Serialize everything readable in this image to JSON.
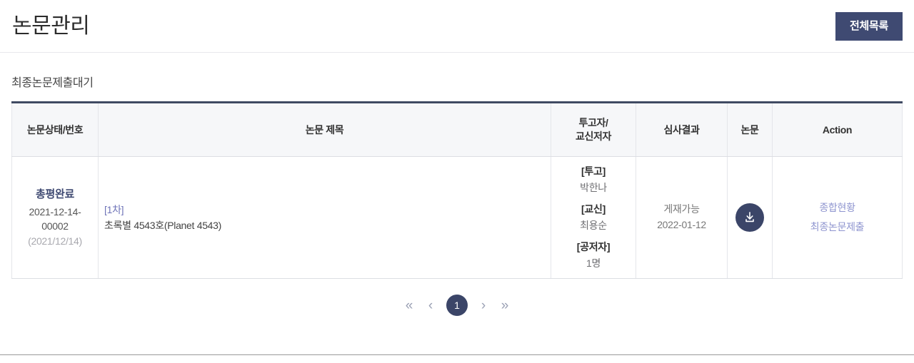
{
  "header": {
    "title": "논문관리",
    "full_list_button": "전체목록"
  },
  "section": {
    "label": "최종논문제출대기"
  },
  "table": {
    "columns": [
      {
        "key": "status",
        "label": "논문상태/번호"
      },
      {
        "key": "title",
        "label": "논문 제목"
      },
      {
        "key": "author",
        "label": "투고자/\n교신저자",
        "line1": "투고자/",
        "line2": "교신저자"
      },
      {
        "key": "result",
        "label": "심사결과"
      },
      {
        "key": "paper",
        "label": "논문"
      },
      {
        "key": "action",
        "label": "Action"
      }
    ],
    "rows": [
      {
        "status_name": "총평완료",
        "status_number": "2021-12-14-00002",
        "status_date": "(2021/12/14)",
        "title_round": "[1차]",
        "title_text": "초록별 4543호(Planet 4543)",
        "authors": [
          {
            "role": "[투고]",
            "name": "박한나"
          },
          {
            "role": "[교신]",
            "name": "최용순"
          },
          {
            "role": "[공저자]",
            "name": "1명"
          }
        ],
        "result_text": "게재가능",
        "result_date": "2022-01-12",
        "paper_icon": "download-icon",
        "actions": [
          {
            "label": "종합현황"
          },
          {
            "label": "최종논문제출"
          }
        ]
      }
    ]
  },
  "pagination": {
    "first": "«",
    "prev": "‹",
    "current_page": "1",
    "next": "›",
    "last": "»"
  },
  "colors": {
    "primary_navy": "#3f4a72",
    "table_top_border": "#3f4a62",
    "link_blue": "#8e94cf",
    "round_link": "#6f74b8",
    "muted_gray": "#a8a8ae"
  }
}
